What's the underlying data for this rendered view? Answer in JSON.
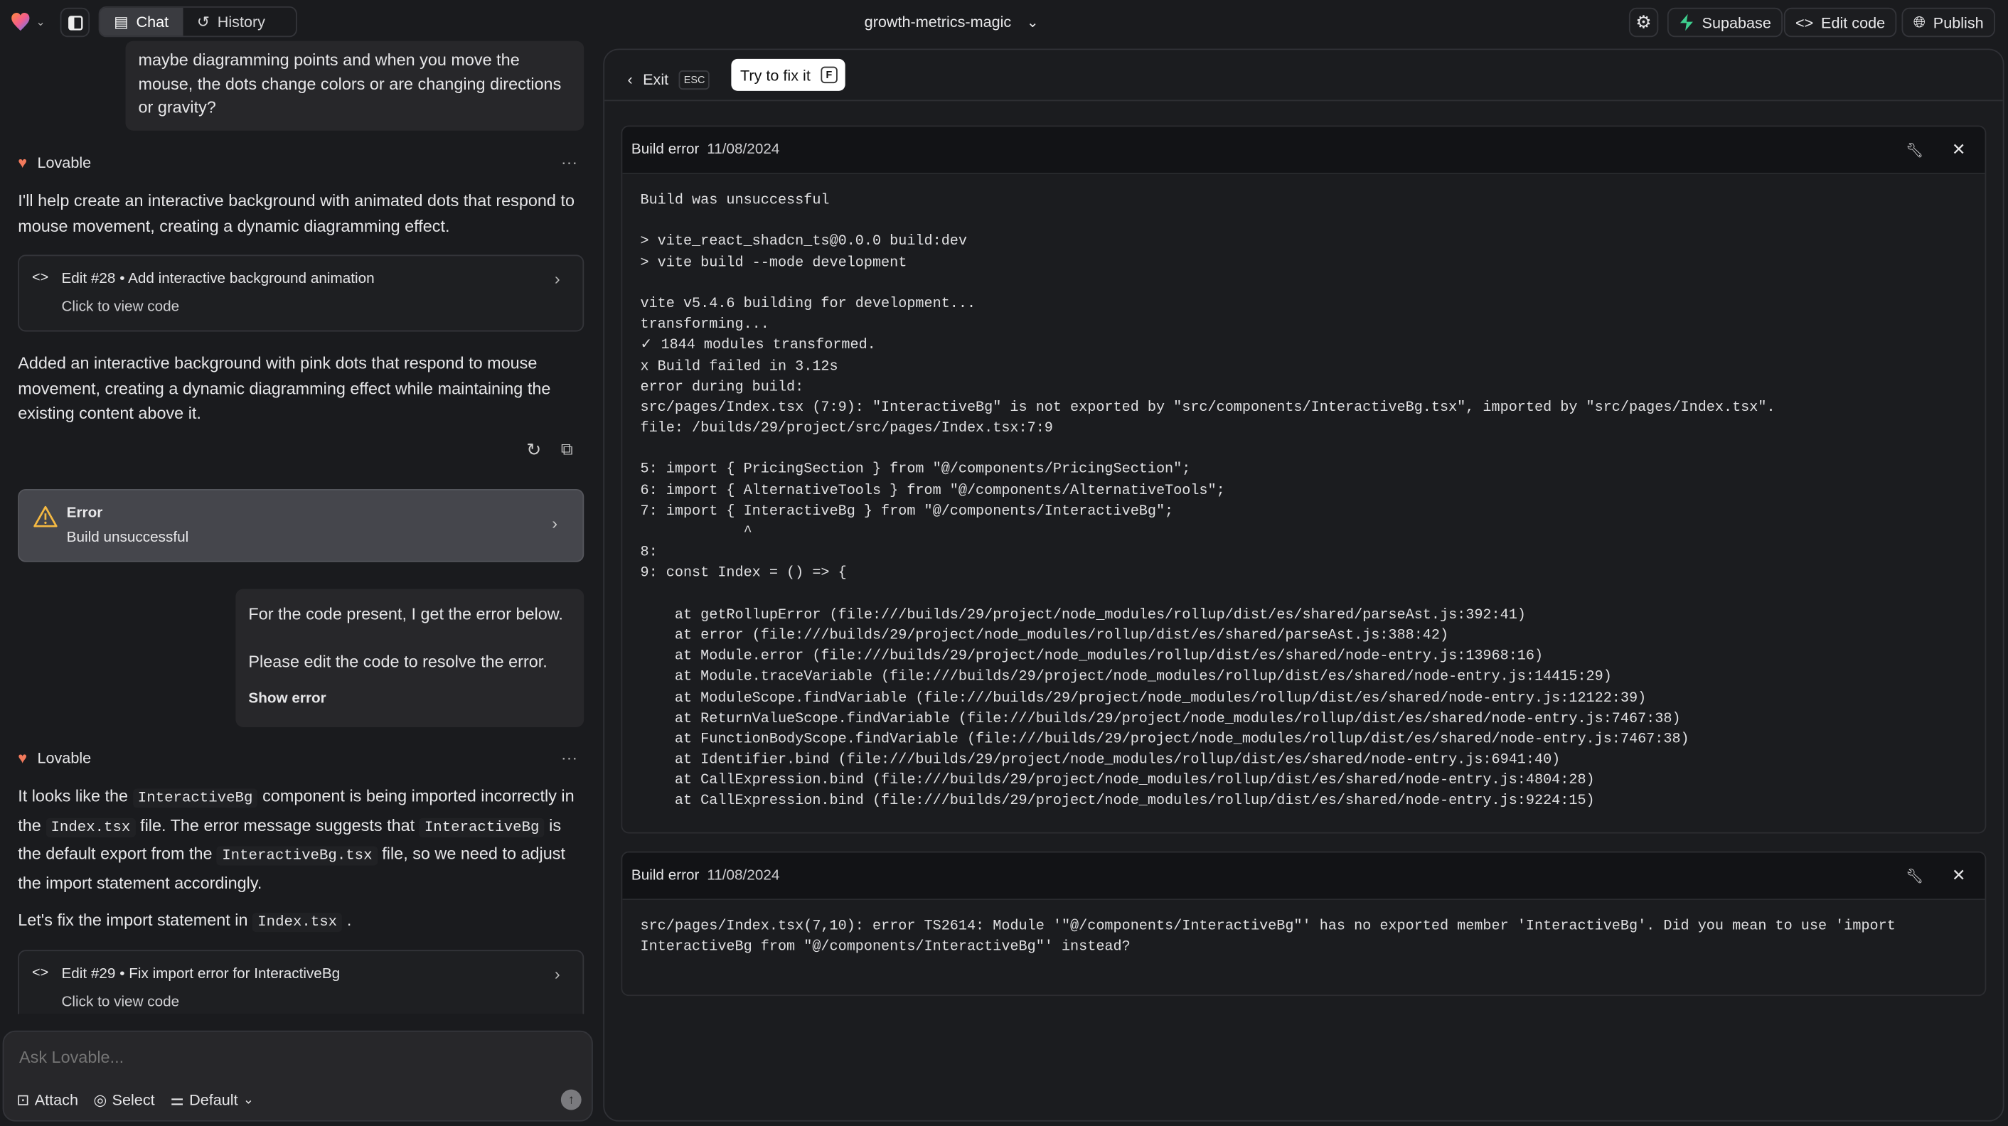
{
  "topbar": {
    "project_name": "growth-metrics-magic",
    "tabs": [
      {
        "label": "Chat",
        "active": true
      },
      {
        "label": "History",
        "active": false
      }
    ],
    "supabase": "Supabase",
    "edit_code": "Edit code",
    "publish": "Publish",
    "supabase_color": "#3ecf8e"
  },
  "chat": {
    "user_msg_1": "maybe diagramming points and when you move the mouse, the dots change colors or are changing directions or gravity?",
    "assistant_name": "Lovable",
    "reply_1": "I'll help create an interactive background with animated dots that respond to mouse movement, creating a dynamic diagramming effect.",
    "edit_28": {
      "title": "Edit #28 • Add interactive background animation",
      "sub": "Click to view code"
    },
    "reply_1b": "Added an interactive background with pink dots that respond to mouse movement, creating a dynamic diagramming effect while maintaining the existing content above it.",
    "error_card": {
      "title": "Error",
      "sub": "Build unsuccessful"
    },
    "user_msg_2": {
      "line1": "For the code present, I get the error below.",
      "line2": "Please edit the code to resolve the error.",
      "show_error": "Show error"
    },
    "reply_2": [
      {
        "t": "It looks like the "
      },
      {
        "t": "InteractiveBg",
        "code": true
      },
      {
        "t": " component is being imported incorrectly in the "
      },
      {
        "t": "Index.tsx",
        "code": true
      },
      {
        "t": " file. The error message suggests that "
      },
      {
        "t": "InteractiveBg",
        "code": true
      },
      {
        "t": " is the default export from the "
      },
      {
        "t": "InteractiveBg.tsx",
        "code": true
      },
      {
        "t": " file, so we need to adjust the import statement accordingly."
      }
    ],
    "reply_3": [
      {
        "t": "Let's fix the import statement in "
      },
      {
        "t": "Index.tsx",
        "code": true
      },
      {
        "t": " ."
      }
    ],
    "edit_29": {
      "title": "Edit #29 • Fix import error for InteractiveBg",
      "sub": "Click to view code"
    },
    "input": {
      "placeholder": "Ask Lovable...",
      "attach": "Attach",
      "select": "Select",
      "mode": "Default"
    }
  },
  "panel": {
    "exit": "Exit",
    "exit_key": "ESC",
    "try_fix": "Try to fix it",
    "try_fix_key": "F",
    "errors": [
      {
        "title": "Build error",
        "date": "11/08/2024",
        "lines": [
          "Build was unsuccessful",
          "",
          "> vite_react_shadcn_ts@0.0.0 build:dev",
          "> vite build --mode development",
          "",
          "vite v5.4.6 building for development...",
          "transforming...",
          "✓ 1844 modules transformed.",
          "x Build failed in 3.12s",
          "error during build:",
          "src/pages/Index.tsx (7:9): \"InteractiveBg\" is not exported by \"src/components/InteractiveBg.tsx\", imported by \"src/pages/Index.tsx\".",
          "file: /builds/29/project/src/pages/Index.tsx:7:9",
          "",
          "5: import { PricingSection } from \"@/components/PricingSection\";",
          "6: import { AlternativeTools } from \"@/components/AlternativeTools\";",
          "7: import { InteractiveBg } from \"@/components/InteractiveBg\";",
          "            ^",
          "8:",
          "9: const Index = () => {",
          "",
          "    at getRollupError (file:///builds/29/project/node_modules/rollup/dist/es/shared/parseAst.js:392:41)",
          "    at error (file:///builds/29/project/node_modules/rollup/dist/es/shared/parseAst.js:388:42)",
          "    at Module.error (file:///builds/29/project/node_modules/rollup/dist/es/shared/node-entry.js:13968:16)",
          "    at Module.traceVariable (file:///builds/29/project/node_modules/rollup/dist/es/shared/node-entry.js:14415:29)",
          "    at ModuleScope.findVariable (file:///builds/29/project/node_modules/rollup/dist/es/shared/node-entry.js:12122:39)",
          "    at ReturnValueScope.findVariable (file:///builds/29/project/node_modules/rollup/dist/es/shared/node-entry.js:7467:38)",
          "    at FunctionBodyScope.findVariable (file:///builds/29/project/node_modules/rollup/dist/es/shared/node-entry.js:7467:38)",
          "    at Identifier.bind (file:///builds/29/project/node_modules/rollup/dist/es/shared/node-entry.js:6941:40)",
          "    at CallExpression.bind (file:///builds/29/project/node_modules/rollup/dist/es/shared/node-entry.js:4804:28)",
          "    at CallExpression.bind (file:///builds/29/project/node_modules/rollup/dist/es/shared/node-entry.js:9224:15)"
        ]
      },
      {
        "title": "Build error",
        "date": "11/08/2024",
        "lines": [
          "src/pages/Index.tsx(7,10): error TS2614: Module '\"@/components/InteractiveBg\"' has no exported member 'InteractiveBg'. Did you mean to use 'import",
          "InteractiveBg from \"@/components/InteractiveBg\"' instead?"
        ]
      }
    ]
  }
}
